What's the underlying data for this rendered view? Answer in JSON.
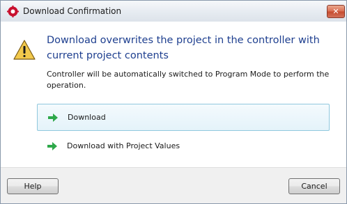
{
  "window": {
    "title": "Download Confirmation",
    "close_glyph": "✕",
    "app_icon": "red-gear-icon"
  },
  "message": {
    "icon": "warning-icon",
    "heading": "Download overwrites the project in the controller with current project contents",
    "description": "Controller will be automatically switched to Program Mode to perform the operation."
  },
  "options": [
    {
      "label": "Download",
      "icon": "green-arrow-icon",
      "selected": true
    },
    {
      "label": "Download with Project Values",
      "icon": "green-arrow-icon",
      "selected": false
    }
  ],
  "footer": {
    "help_label": "Help",
    "cancel_label": "Cancel"
  },
  "colors": {
    "heading": "#1e3f8f",
    "selected_border": "#90c8dd",
    "arrow": "#2ea84a",
    "warning": "#f2c94c"
  }
}
